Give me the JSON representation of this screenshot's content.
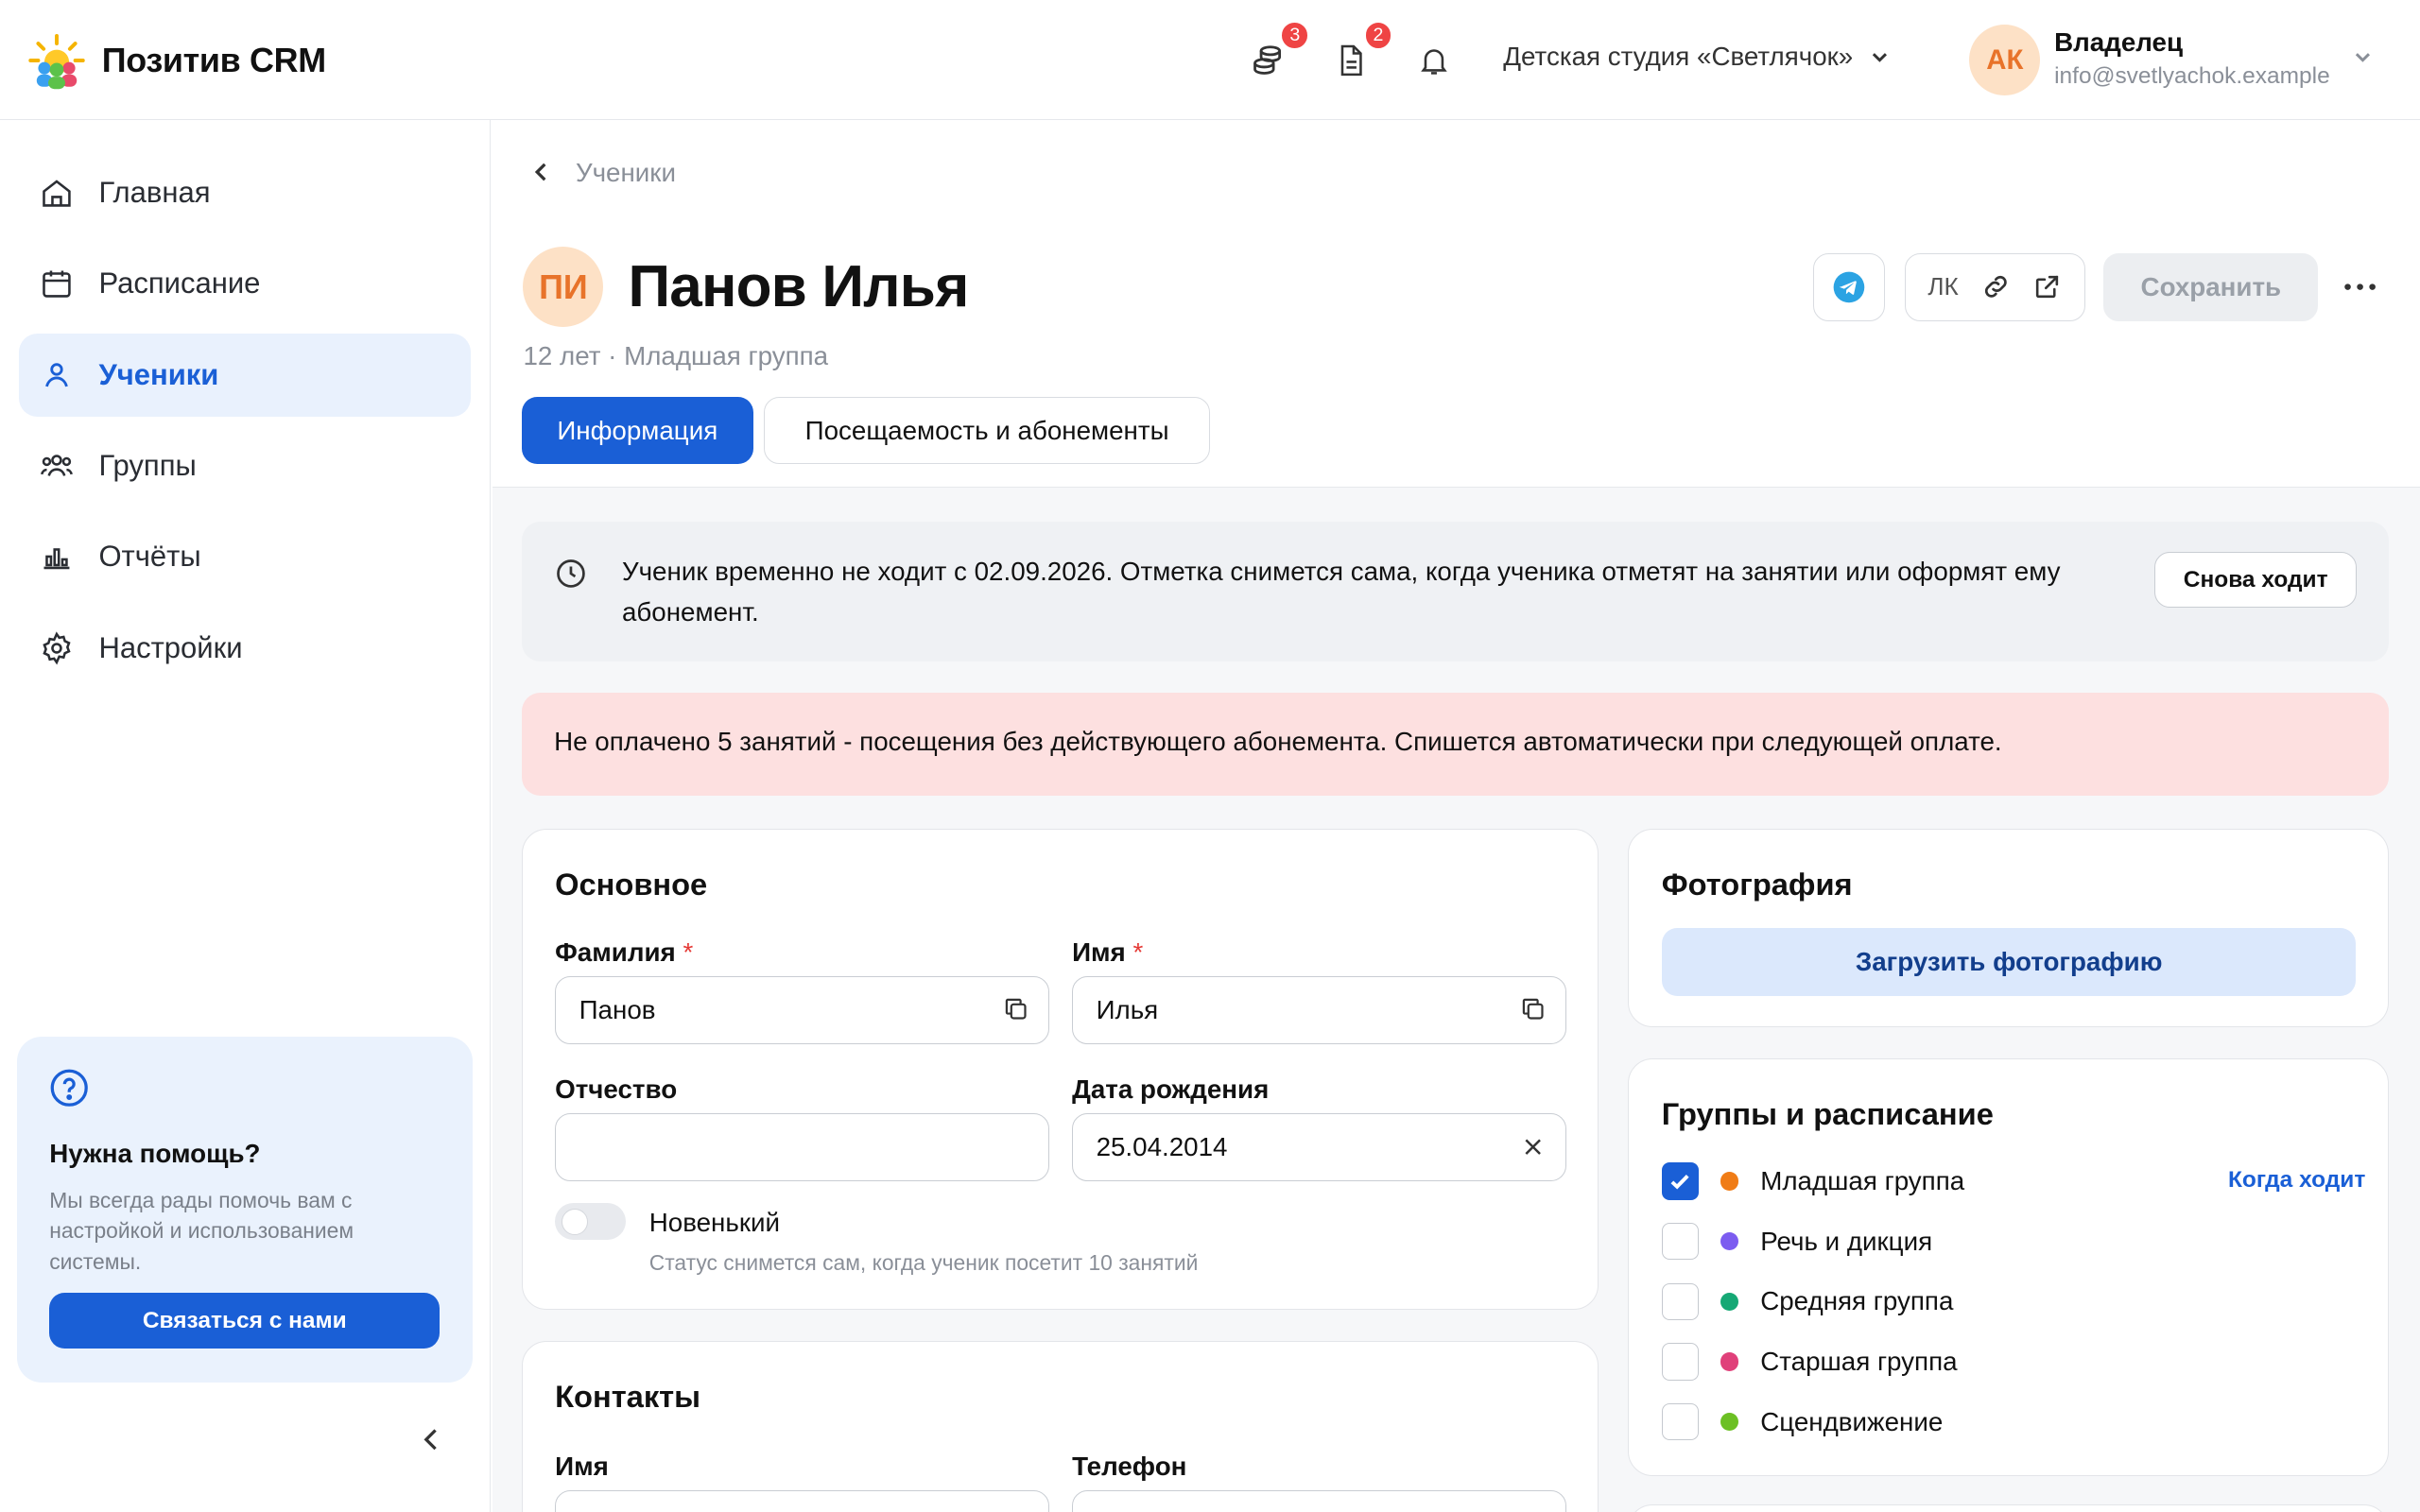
{
  "app": {
    "name": "Позитив CRM"
  },
  "header": {
    "payments_badge": "3",
    "docs_badge": "2",
    "studio_name": "Детская студия «Светлячок»",
    "user": {
      "initials": "АК",
      "role": "Владелец",
      "email": "info@svetlyachok.example"
    }
  },
  "sidebar": {
    "items": [
      {
        "label": "Главная",
        "icon": "home-icon"
      },
      {
        "label": "Расписание",
        "icon": "calendar-icon"
      },
      {
        "label": "Ученики",
        "icon": "user-icon",
        "active": true
      },
      {
        "label": "Группы",
        "icon": "users-icon"
      },
      {
        "label": "Отчёты",
        "icon": "chart-icon"
      },
      {
        "label": "Настройки",
        "icon": "gear-icon"
      }
    ],
    "help": {
      "title": "Нужна помощь?",
      "text": "Мы всегда рады помочь вам с настройкой и использованием системы.",
      "button": "Связаться с нами"
    }
  },
  "breadcrumb": {
    "back_label": "Ученики"
  },
  "student": {
    "initials": "ПИ",
    "full_name": "Панов Илья",
    "subtitle": "12 лет · Младшая группа"
  },
  "actions": {
    "lk_label": "ЛК",
    "save_label": "Сохранить"
  },
  "tabs": [
    {
      "label": "Информация",
      "active": true
    },
    {
      "label": "Посещаемость и абонементы",
      "active": false
    }
  ],
  "notice": {
    "text": "Ученик временно не ходит с 02.09.2026. Отметка снимется сама, когда ученика отметят на занятии или оформят ему абонемент.",
    "button": "Снова ходит"
  },
  "alert": {
    "text": "Не оплачено 5 занятий - посещения без действующего абонемента. Спишется автоматически при следующей оплате."
  },
  "basic": {
    "title": "Основное",
    "last_name_label": "Фамилия",
    "last_name_value": "Панов",
    "first_name_label": "Имя",
    "first_name_value": "Илья",
    "middle_name_label": "Отчество",
    "middle_name_value": "",
    "birth_label": "Дата рождения",
    "birth_value": "25.04.2014",
    "required_mark": "*",
    "newbie_label": "Новенький",
    "newbie_on": false,
    "newbie_hint": "Статус снимется сам, когда ученик посетит 10 занятий"
  },
  "contacts": {
    "title": "Контакты",
    "name_label": "Имя",
    "phone_label": "Телефон"
  },
  "photo": {
    "title": "Фотография",
    "upload_label": "Загрузить фотографию"
  },
  "groups": {
    "title": "Группы и расписание",
    "when_label": "Когда ходит",
    "items": [
      {
        "name": "Младшая группа",
        "checked": true,
        "color": "#f07c16"
      },
      {
        "name": "Речь и дикция",
        "checked": false,
        "color": "#7c5cf0"
      },
      {
        "name": "Средняя группа",
        "checked": false,
        "color": "#16a875"
      },
      {
        "name": "Старшая группа",
        "checked": false,
        "color": "#e0407a"
      },
      {
        "name": "Сцендвижение",
        "checked": false,
        "color": "#6cc024"
      }
    ]
  },
  "colors": {
    "accent": "#1a5fd6",
    "alert_bg": "#fde0e0",
    "notice_bg": "#eff1f4"
  }
}
